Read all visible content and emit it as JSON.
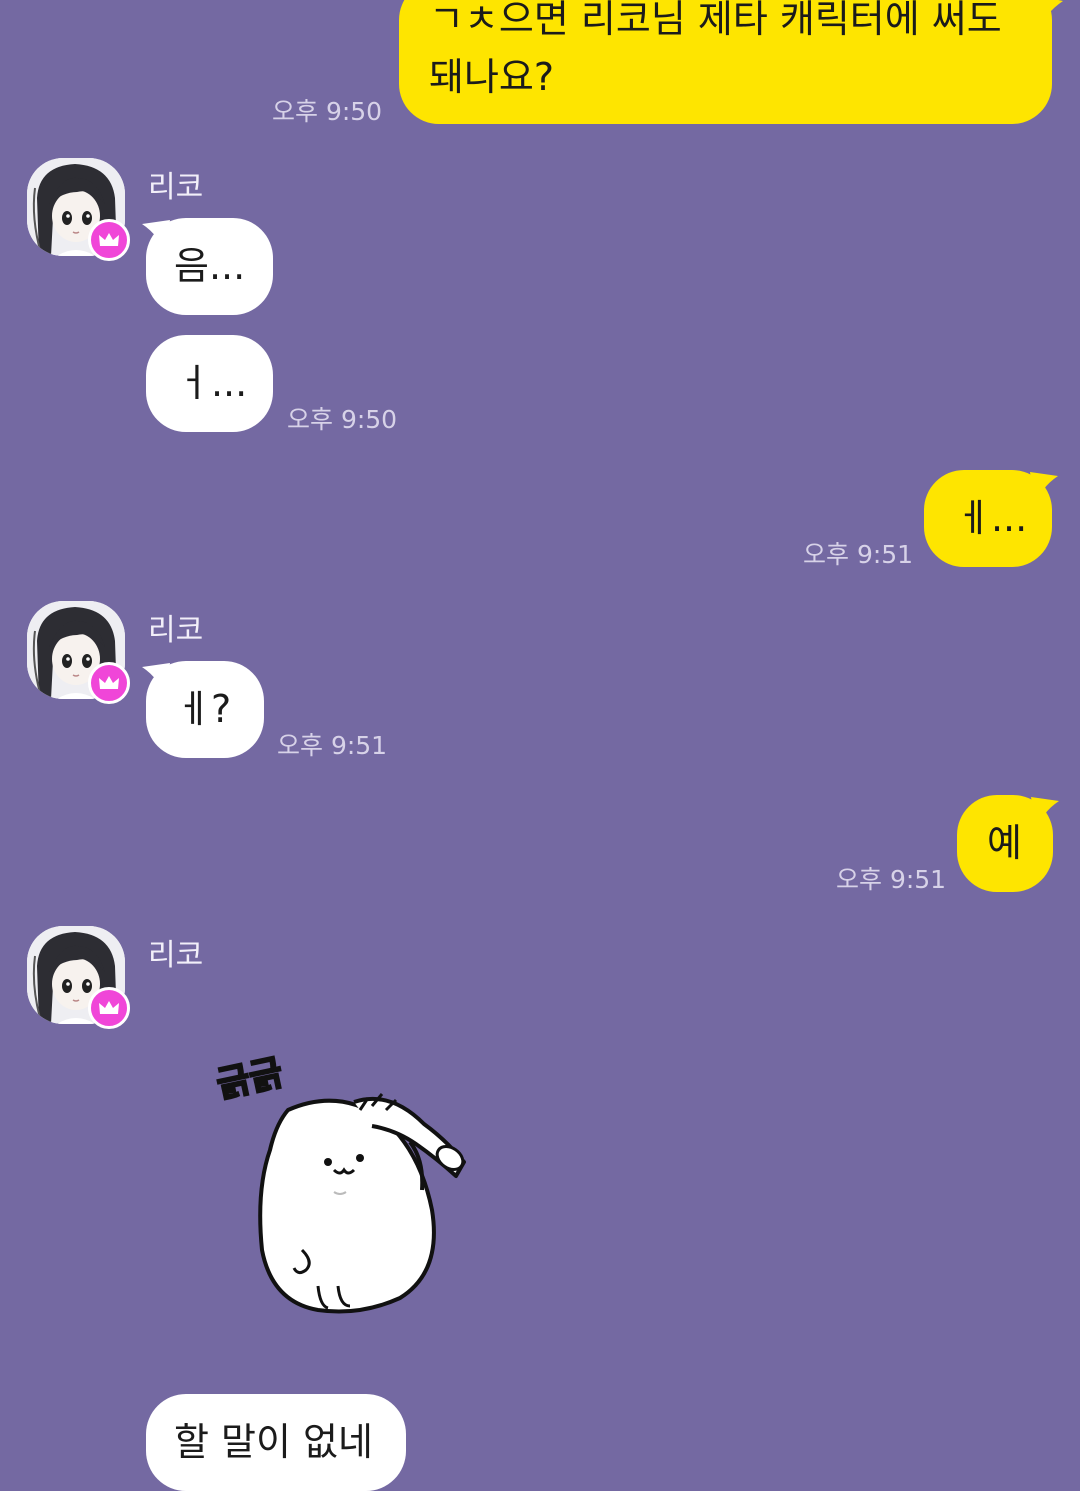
{
  "colors": {
    "background": "#7469a2",
    "my_bubble": "#fee500",
    "their_bubble": "#ffffff",
    "badge": "#f046d8"
  },
  "messages": {
    "m1": {
      "line1": "ㄱㅊ으면 리코님 제타 캐릭터에 써도",
      "line2": "돼나요?",
      "time": "오후 9:50"
    },
    "g1": {
      "sender": "리코",
      "b1": "음...",
      "b2": "ㅓ...",
      "time": "오후 9:50"
    },
    "m2": {
      "text": "ㅔ...",
      "time": "오후 9:51"
    },
    "g2": {
      "sender": "리코",
      "b1": "ㅔ?",
      "time": "오후 9:51"
    },
    "m3": {
      "text": "예",
      "time": "오후 9:51"
    },
    "g3": {
      "sender": "리코",
      "sticker_caption": "긁긁",
      "partial": "할 말이 없네"
    }
  },
  "icons": {
    "avatar": "anime-girl-avatar",
    "badge": "crown-icon",
    "sticker": "white-seal-scratching-head"
  }
}
